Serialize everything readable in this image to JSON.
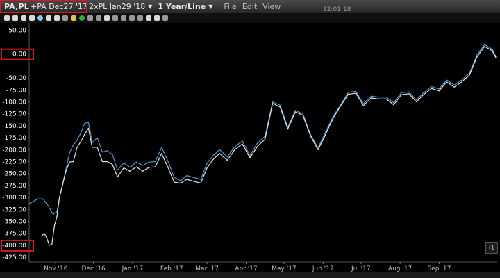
{
  "window": {
    "instrument": "PA,PL",
    "spread_leg1": "+PA Dec27 '17",
    "spread_leg2": "2xPL Jan29 '18",
    "period": "1 Year/Line",
    "menu": [
      "File",
      "Edit",
      "View"
    ],
    "last_update": "12:01:18",
    "side_widget_label": "(1"
  },
  "colors": {
    "background": "#000000",
    "series_blue": "#4a9bd8",
    "series_white": "#e6e6e6",
    "highlight": "#e0121b"
  },
  "chart_data": {
    "type": "line",
    "title": "",
    "xlabel": "",
    "ylabel": "",
    "y_axis_side": "left",
    "ylim": [
      -435,
      65
    ],
    "yticks": [
      50,
      0,
      -50,
      -75,
      -100,
      -125,
      -150,
      -175,
      -200,
      -225,
      -250,
      -275,
      -300,
      -325,
      -350,
      -375,
      -400,
      -425
    ],
    "ytick_labels": [
      "50.00",
      "0.00",
      "-50.00",
      "-75.00",
      "-100.00",
      "-125.00",
      "-150.00",
      "-175.00",
      "-200.00",
      "-225.00",
      "-250.00",
      "-275.00",
      "-300.00",
      "-325.00",
      "-350.00",
      "-375.00",
      "-400.00",
      "-425.00"
    ],
    "xlim": [
      "2016-10-25",
      "2017-10-31"
    ],
    "xticks": [
      "2016-11-15",
      "2016-12-15",
      "2017-01-15",
      "2017-02-15",
      "2017-03-15",
      "2017-04-15",
      "2017-05-15",
      "2017-06-15",
      "2017-07-15",
      "2017-08-15",
      "2017-09-15"
    ],
    "xtick_labels": [
      "Nov '16",
      "Dec '16",
      "Jan '17",
      "Feb '17",
      "Mar '17",
      "Apr '17",
      "May '17",
      "Jun '17",
      "Jul '17",
      "Aug '17",
      "Sep '17"
    ],
    "grid": false,
    "legend": "none",
    "series": [
      {
        "color": "#4a9bd8",
        "x": [
          "2016-10-25",
          "2016-11-01",
          "2016-11-05",
          "2016-11-09",
          "2016-11-13",
          "2016-11-16",
          "2016-11-19",
          "2016-11-22",
          "2016-11-26",
          "2016-11-29",
          "2016-12-02",
          "2016-12-05",
          "2016-12-08",
          "2016-12-11",
          "2016-12-14",
          "2016-12-18",
          "2016-12-22",
          "2016-12-26",
          "2016-12-30",
          "2017-01-03",
          "2017-01-08",
          "2017-01-13",
          "2017-01-18",
          "2017-01-23",
          "2017-01-28",
          "2017-02-02",
          "2017-02-07",
          "2017-02-12",
          "2017-02-17",
          "2017-02-22",
          "2017-02-27",
          "2017-03-04",
          "2017-03-10",
          "2017-03-15",
          "2017-03-20",
          "2017-03-25",
          "2017-03-31",
          "2017-04-06",
          "2017-04-12",
          "2017-04-18",
          "2017-04-24",
          "2017-04-30",
          "2017-05-06",
          "2017-05-12",
          "2017-05-18",
          "2017-05-24",
          "2017-05-30",
          "2017-06-05",
          "2017-06-11",
          "2017-06-17",
          "2017-06-23",
          "2017-06-29",
          "2017-07-05",
          "2017-07-11",
          "2017-07-17",
          "2017-07-23",
          "2017-07-29",
          "2017-08-04",
          "2017-08-10",
          "2017-08-16",
          "2017-08-22",
          "2017-08-28",
          "2017-09-03",
          "2017-09-09",
          "2017-09-15",
          "2017-09-21",
          "2017-09-27",
          "2017-10-03",
          "2017-10-09",
          "2017-10-15",
          "2017-10-21",
          "2017-10-27",
          "2017-10-30"
        ],
        "y": [
          -313,
          -303,
          -303,
          -317,
          -335,
          -330,
          -288,
          -255,
          -207,
          -190,
          -180,
          -165,
          -145,
          -143,
          -185,
          -175,
          -205,
          -202,
          -210,
          -243,
          -228,
          -237,
          -226,
          -233,
          -226,
          -225,
          -195,
          -224,
          -258,
          -265,
          -254,
          -258,
          -262,
          -228,
          -212,
          -200,
          -215,
          -194,
          -182,
          -212,
          -186,
          -172,
          -100,
          -107,
          -153,
          -118,
          -125,
          -168,
          -196,
          -163,
          -130,
          -106,
          -80,
          -78,
          -104,
          -88,
          -90,
          -90,
          -102,
          -81,
          -79,
          -96,
          -80,
          -68,
          -73,
          -54,
          -65,
          -54,
          -40,
          -2,
          20,
          10,
          -5
        ]
      },
      {
        "color": "#e6e6e6",
        "x": [
          "2016-11-04",
          "2016-11-06",
          "2016-11-08",
          "2016-11-10",
          "2016-11-12",
          "2016-11-14",
          "2016-11-16",
          "2016-11-18",
          "2016-11-20",
          "2016-11-23",
          "2016-11-26",
          "2016-11-29",
          "2016-12-02",
          "2016-12-05",
          "2016-12-08",
          "2016-12-11",
          "2016-12-14",
          "2016-12-18",
          "2016-12-22",
          "2016-12-26",
          "2016-12-30",
          "2017-01-03",
          "2017-01-08",
          "2017-01-13",
          "2017-01-18",
          "2017-01-23",
          "2017-01-28",
          "2017-02-02",
          "2017-02-07",
          "2017-02-12",
          "2017-02-17",
          "2017-02-22",
          "2017-02-27",
          "2017-03-04",
          "2017-03-10",
          "2017-03-15",
          "2017-03-20",
          "2017-03-25",
          "2017-03-31",
          "2017-04-06",
          "2017-04-12",
          "2017-04-18",
          "2017-04-24",
          "2017-04-30",
          "2017-05-06",
          "2017-05-12",
          "2017-05-18",
          "2017-05-24",
          "2017-05-30",
          "2017-06-05",
          "2017-06-11",
          "2017-06-17",
          "2017-06-23",
          "2017-06-29",
          "2017-07-05",
          "2017-07-11",
          "2017-07-17",
          "2017-07-23",
          "2017-07-29",
          "2017-08-04",
          "2017-08-10",
          "2017-08-16",
          "2017-08-22",
          "2017-08-28",
          "2017-09-03",
          "2017-09-09",
          "2017-09-15",
          "2017-09-21",
          "2017-09-27",
          "2017-10-03",
          "2017-10-09",
          "2017-10-15",
          "2017-10-21",
          "2017-10-27",
          "2017-10-30"
        ],
        "y": [
          -380,
          -375,
          -385,
          -400,
          -398,
          -360,
          -340,
          -300,
          -280,
          -246,
          -226,
          -225,
          -195,
          -183,
          -168,
          -155,
          -195,
          -195,
          -225,
          -225,
          -231,
          -257,
          -238,
          -245,
          -236,
          -245,
          -237,
          -236,
          -208,
          -237,
          -268,
          -270,
          -262,
          -266,
          -270,
          -238,
          -220,
          -208,
          -222,
          -200,
          -188,
          -217,
          -193,
          -178,
          -103,
          -111,
          -157,
          -121,
          -128,
          -171,
          -200,
          -168,
          -134,
          -108,
          -84,
          -82,
          -108,
          -92,
          -94,
          -94,
          -106,
          -85,
          -83,
          -100,
          -84,
          -72,
          -77,
          -58,
          -69,
          -58,
          -44,
          -6,
          16,
          7,
          -8
        ]
      }
    ]
  }
}
